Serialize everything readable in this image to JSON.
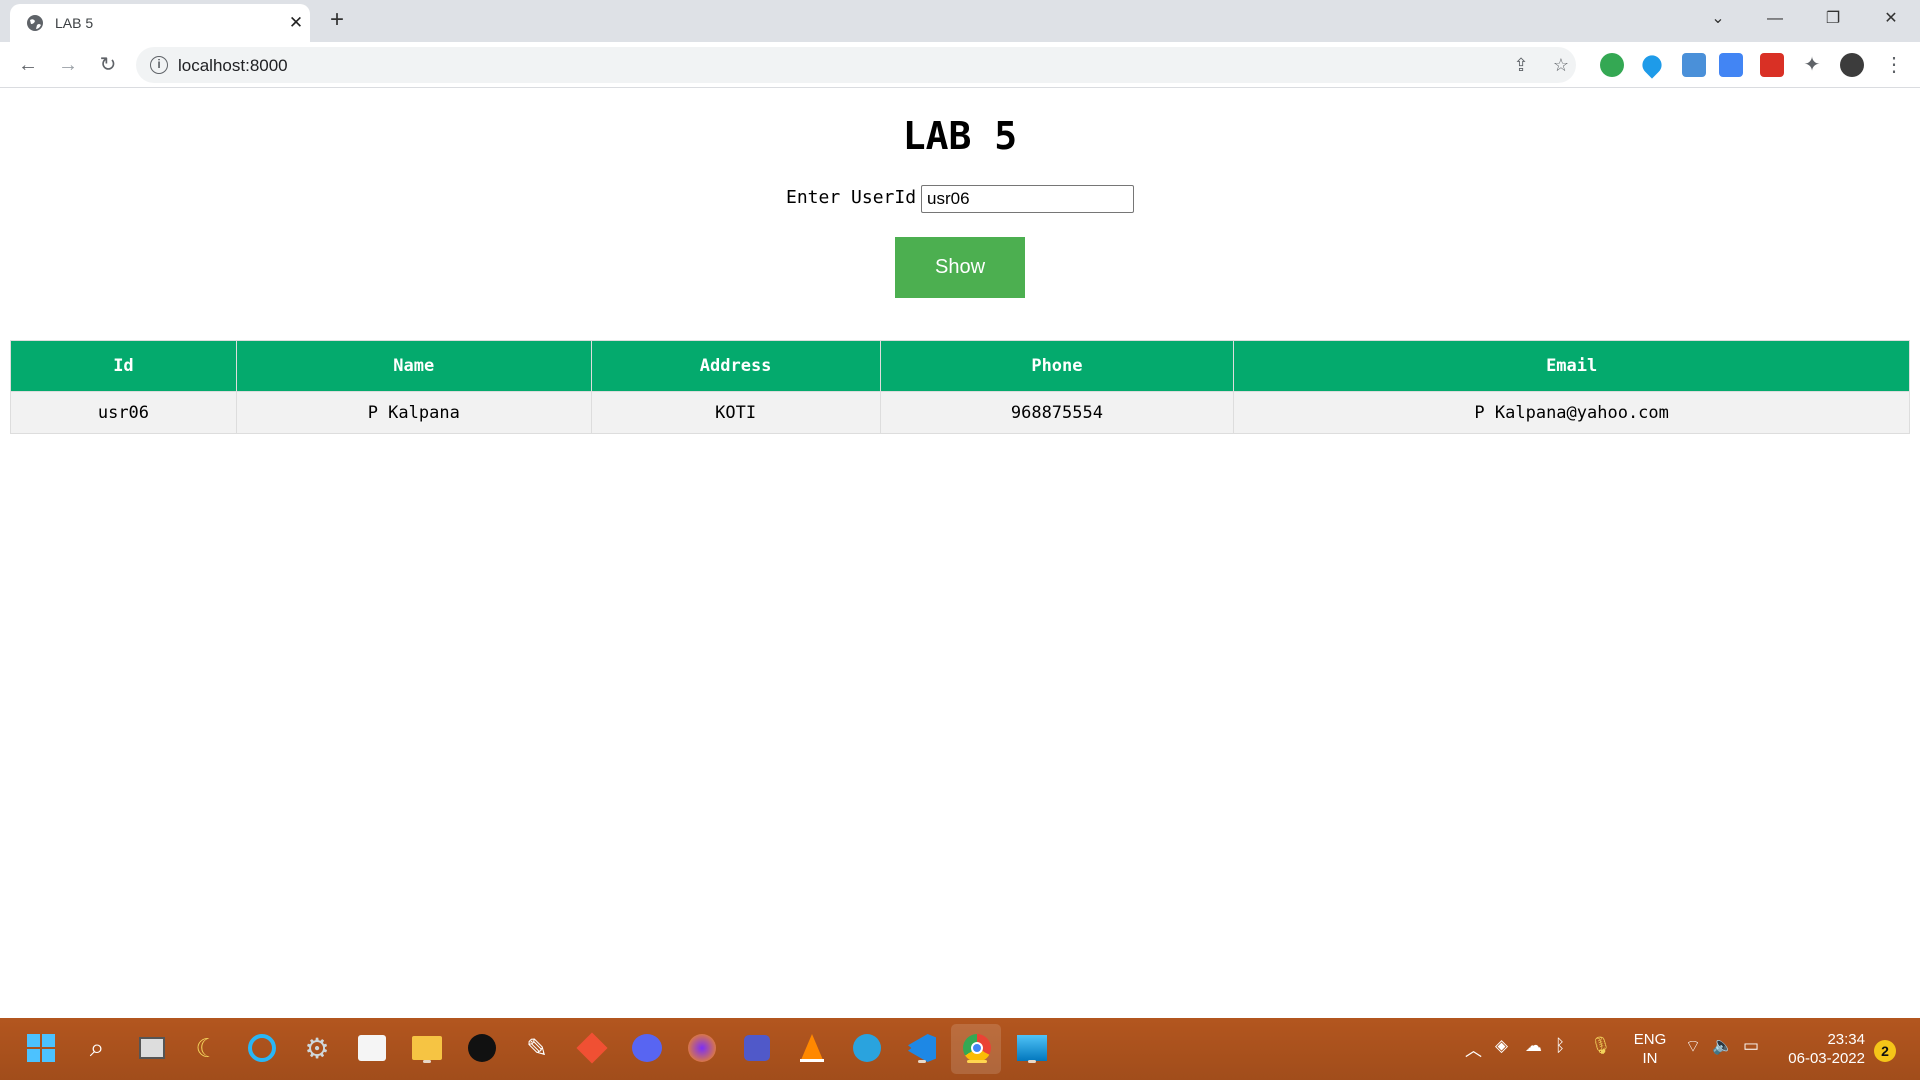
{
  "browser": {
    "tab_title": "LAB 5",
    "url": "localhost:8000",
    "icons": [
      "globe-icon",
      "close-icon",
      "new-tab-icon",
      "back-icon",
      "forward-icon",
      "reload-icon",
      "site-info-icon",
      "share-icon",
      "star-icon",
      "extensions-icon",
      "profile-avatar",
      "menu-icon"
    ]
  },
  "page": {
    "heading": "LAB 5",
    "userid_label": "Enter UserId",
    "userid_value": "usr06",
    "show_button": "Show"
  },
  "table": {
    "headers": [
      "Id",
      "Name",
      "Address",
      "Phone",
      "Email"
    ],
    "rows": [
      [
        "usr06",
        "P Kalpana",
        "KOTI",
        "968875554",
        "P Kalpana@yahoo.com"
      ]
    ],
    "header_color": "#04aa6d"
  },
  "taskbar": {
    "lang_line1": "ENG",
    "lang_line2": "IN",
    "time": "23:34",
    "date": "06-03-2022",
    "notification_count": "2"
  }
}
